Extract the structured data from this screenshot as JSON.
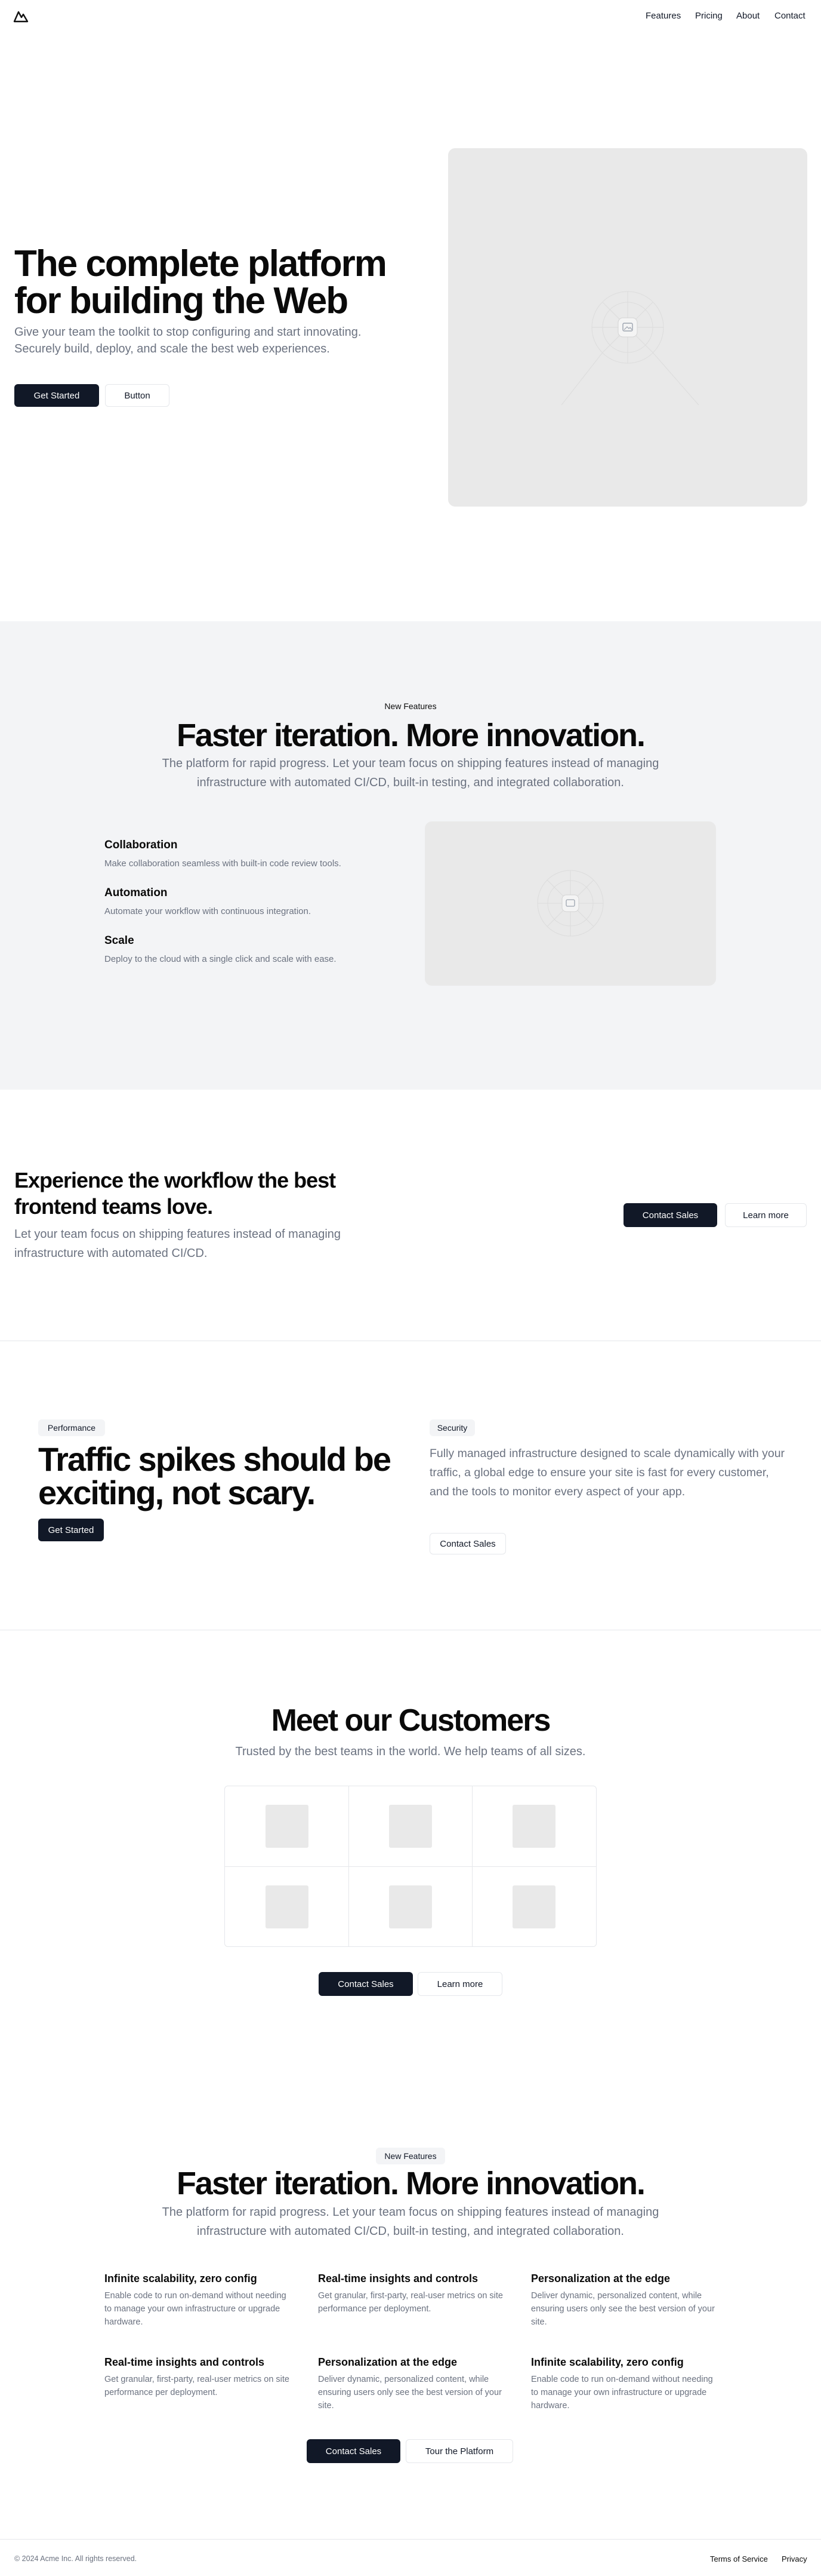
{
  "nav": {
    "links": [
      "Features",
      "Pricing",
      "About",
      "Contact"
    ]
  },
  "hero": {
    "title_line1": "The complete platform",
    "title_line2": "for building the Web",
    "subtitle": "Give your team the toolkit to stop configuring and start innovating. Securely build, deploy, and scale the best web experiences.",
    "primary_label": "Get Started",
    "secondary_label": "Button"
  },
  "features": {
    "badge": "New Features",
    "title": "Faster iteration. More innovation.",
    "subtitle": "The platform for rapid progress. Let your team focus on shipping features instead of managing infrastructure with automated CI/CD, built-in testing, and integrated collaboration.",
    "items": [
      {
        "title": "Collaboration",
        "desc": "Make collaboration seamless with built-in code review tools."
      },
      {
        "title": "Automation",
        "desc": "Automate your workflow with continuous integration."
      },
      {
        "title": "Scale",
        "desc": "Deploy to the cloud with a single click and scale with ease."
      }
    ]
  },
  "cta": {
    "title_line1": "Experience the workflow the best",
    "title_line2": "frontend teams love.",
    "subtitle": "Let your team focus on shipping features instead of managing infrastructure with automated CI/CD.",
    "primary_label": "Contact Sales",
    "secondary_label": "Learn more"
  },
  "split": {
    "left_badge": "Performance",
    "title_line1": "Traffic spikes should be",
    "title_line2": "exciting, not scary.",
    "left_button": "Get Started",
    "right_badge": "Security",
    "right_text": "Fully managed infrastructure designed to scale dynamically with your traffic, a global edge to ensure your site is fast for every customer, and the tools to monitor every aspect of your app.",
    "right_button": "Contact Sales"
  },
  "customers": {
    "title": "Meet our Customers",
    "subtitle": "Trusted by the best teams in the world. We help teams of all sizes.",
    "primary_label": "Contact Sales",
    "secondary_label": "Learn more"
  },
  "grid_features": {
    "badge": "New Features",
    "title": "Faster iteration. More innovation.",
    "subtitle": "The platform for rapid progress. Let your team focus on shipping features instead of managing infrastructure with automated CI/CD, built-in testing, and integrated collaboration.",
    "items": [
      {
        "title": "Infinite scalability, zero config",
        "desc": "Enable code to run on-demand without needing to manage your own infrastructure or upgrade hardware."
      },
      {
        "title": "Real-time insights and controls",
        "desc": "Get granular, first-party, real-user metrics on site performance per deployment."
      },
      {
        "title": "Personalization at the edge",
        "desc": "Deliver dynamic, personalized content, while ensuring users only see the best version of your site."
      },
      {
        "title": "Real-time insights and controls",
        "desc": "Get granular, first-party, real-user metrics on site performance per deployment."
      },
      {
        "title": "Personalization at the edge",
        "desc": "Deliver dynamic, personalized content, while ensuring users only see the best version of your site."
      },
      {
        "title": "Infinite scalability, zero config",
        "desc": "Enable code to run on-demand without needing to manage your own infrastructure or upgrade hardware."
      }
    ],
    "primary_label": "Contact Sales",
    "secondary_label": "Tour the Platform"
  },
  "footer": {
    "copyright": "© 2024 Acme Inc. All rights reserved.",
    "links": [
      "Terms of Service",
      "Privacy"
    ]
  },
  "colors": {
    "primary_button": "#111827",
    "section_bg": "#f3f4f6",
    "placeholder": "#e9e9e9",
    "muted_text": "#6b7280"
  },
  "icons": [
    "mountain-logo-icon",
    "image-placeholder-icon"
  ]
}
